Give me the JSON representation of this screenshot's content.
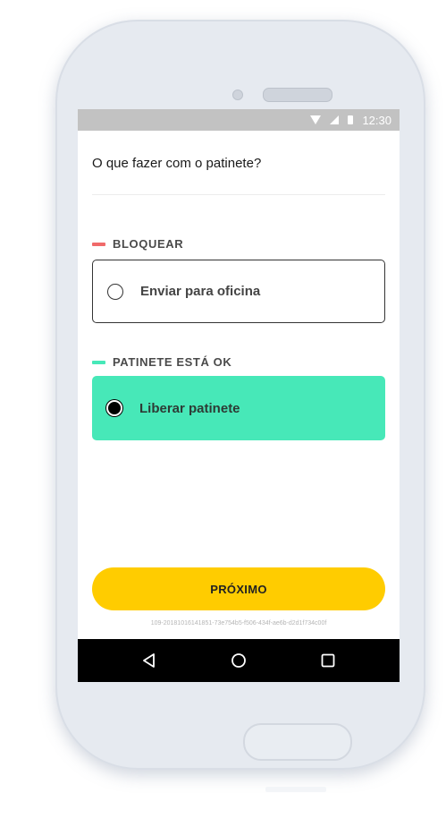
{
  "status_bar": {
    "time": "12:30",
    "icons": [
      "wifi-icon",
      "signal-icon",
      "battery-icon"
    ]
  },
  "page": {
    "title": "O que fazer com o patinete?"
  },
  "sections": [
    {
      "label": "BLOQUEAR",
      "accent_color": "#f06a6a",
      "option": {
        "label": "Enviar para oficina",
        "selected": false
      }
    },
    {
      "label": "PATINETE ESTÁ OK",
      "accent_color": "#47e8b8",
      "option": {
        "label": "Liberar patinete",
        "selected": true
      }
    }
  ],
  "actions": {
    "next_label": "PRÓXIMO"
  },
  "build_id": "109-20181016141851-73e754b5-f506-434f-ae6b-d2d1f734c00f",
  "nav_bar": {
    "icons": [
      "back-icon",
      "home-icon",
      "recents-icon"
    ]
  },
  "colors": {
    "primary_button": "#ffcc00",
    "selected_option_bg": "#47e8b8",
    "block_accent": "#f06a6a",
    "status_bar": "#c2c2c2"
  }
}
